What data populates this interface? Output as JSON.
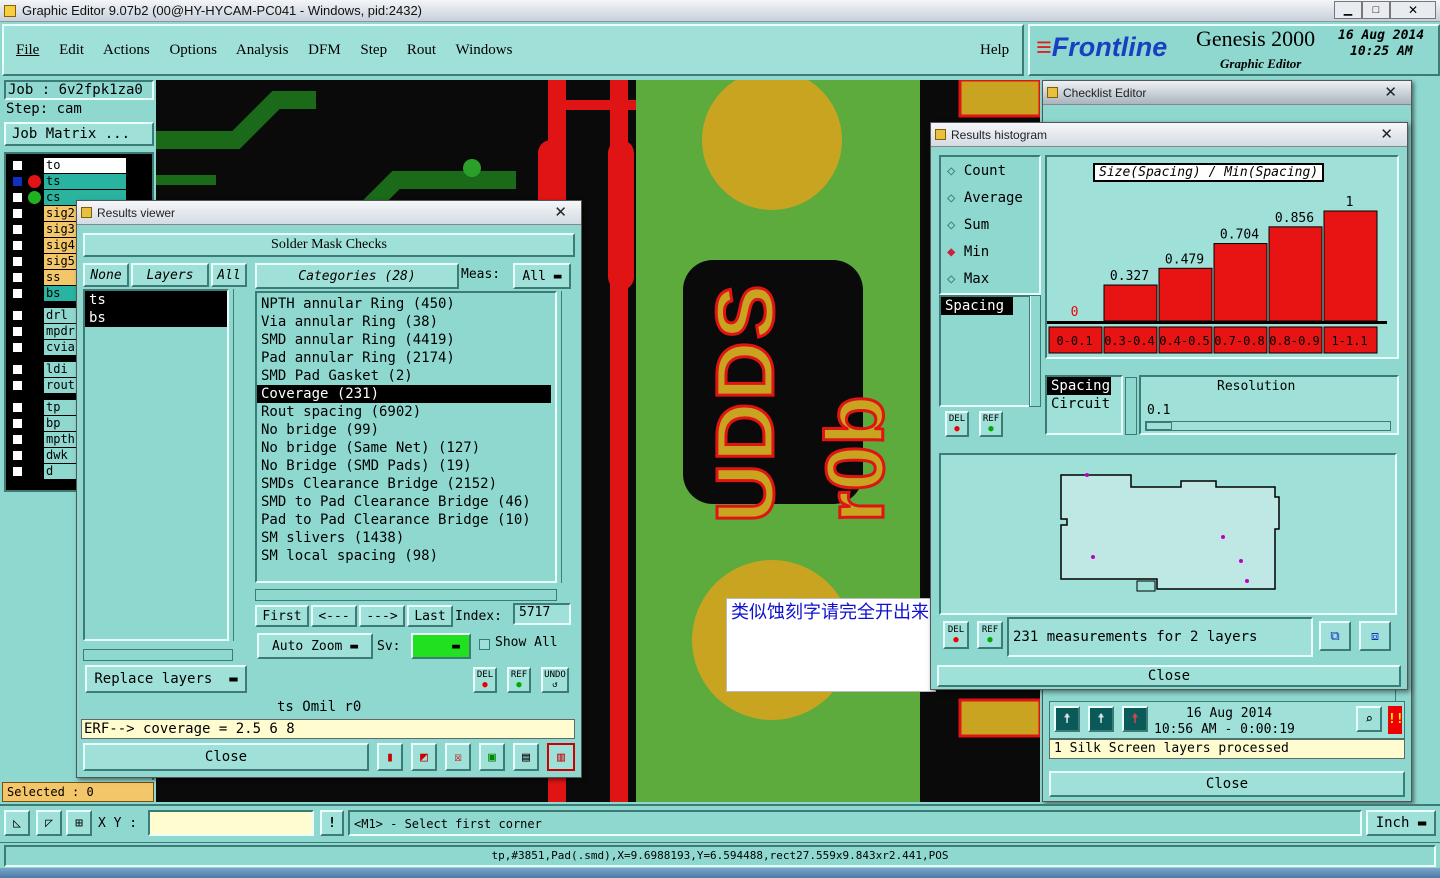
{
  "window": {
    "title": "Graphic Editor 9.07b2 (00@HY-HYCAM-PC041 - Windows, pid:2432)"
  },
  "menu": [
    "File",
    "Edit",
    "Actions",
    "Options",
    "Analysis",
    "DFM",
    "Step",
    "Rout",
    "Windows"
  ],
  "help": "Help",
  "brand": {
    "logo": "Frontline",
    "product": "Genesis 2000",
    "subtitle": "Graphic Editor",
    "date": "16 Aug 2014",
    "time": "10:25 AM"
  },
  "job": {
    "job": "Job : 6v2fpk1za0",
    "step": "Step: cam",
    "matrix": "Job Matrix ..."
  },
  "layers": [
    "to",
    "ts",
    "cs",
    "sig2",
    "sig3",
    "sig4",
    "sig5",
    "ss",
    "bs",
    "drl",
    "mpdr",
    "cvia",
    "ldi",
    "rout",
    "tp",
    "bp",
    "mpth",
    "dwk",
    "d"
  ],
  "selected": "Selected : 0",
  "board": {
    "text1": "UDDS",
    "text2": "r0b"
  },
  "note": "类似蚀刻字请完全开出来",
  "results": {
    "title": "Results viewer",
    "heading": "Solder Mask Checks",
    "none": "None",
    "layers": "Layers",
    "all": "All",
    "categories": "Categories (28)",
    "meas_label": "Meas:",
    "meas_value": "All",
    "layer_items": [
      "ts",
      "bs"
    ],
    "items": [
      "NPTH annular Ring (450)",
      "Via annular Ring (38)",
      "SMD annular Ring (4419)",
      "Pad annular Ring (2174)",
      "SMD Pad Gasket (2)",
      "Coverage (231)",
      "Rout spacing (6902)",
      "No bridge (99)",
      "No bridge (Same Net) (127)",
      "No Bridge (SMD Pads) (19)",
      "SMDs Clearance Bridge (2152)",
      "SMD to Pad Clearance Bridge (46)",
      "Pad to Pad Clearance Bridge (10)",
      "SM slivers (1438)",
      "SM local spacing (98)"
    ],
    "first": "First",
    "prev": "<---",
    "next": "--->",
    "last": "Last",
    "index_label": "Index:",
    "index_value": "5717",
    "auto_zoom": "Auto Zoom",
    "sv": "Sv:",
    "show_all": "Show All",
    "replace": "Replace layers",
    "del": "DEL",
    "ref": "REF",
    "undo": "UNDO",
    "info": "ts Omil r0",
    "erf": "ERF--> coverage = 2.5 6 8",
    "close": "Close"
  },
  "checklist": {
    "title": "Checklist Editor",
    "date": "16 Aug 2014",
    "time": "10:56 AM - 0:00:19",
    "status": "1 Silk Screen layers processed",
    "close": "Close"
  },
  "histogram": {
    "title": "Results histogram",
    "options": [
      "Count",
      "Average",
      "Sum",
      "Min",
      "Max"
    ],
    "selected": "Min",
    "metric": "Spacing",
    "header": "Size(Spacing) / Min(Spacing)",
    "del": "DEL",
    "ref": "REF",
    "bars": [
      {
        "label": "0",
        "value": 0,
        "range": "0-0.1"
      },
      {
        "label": "0.327",
        "value": 0.327,
        "range": "0.3-0.4"
      },
      {
        "label": "0.479",
        "value": 0.479,
        "range": "0.4-0.5"
      },
      {
        "label": "0.704",
        "value": 0.704,
        "range": "0.7-0.8"
      },
      {
        "label": "0.856",
        "value": 0.856,
        "range": "0.8-0.9"
      },
      {
        "label": "1",
        "value": 1,
        "range": "1-1.1"
      }
    ],
    "types": [
      "Spacing",
      "Circuit"
    ],
    "resolution_label": "Resolution",
    "resolution_value": "0.1",
    "measurements": "231 measurements for 2 layers",
    "close": "Close"
  },
  "bottom": {
    "xy": "X Y :",
    "status": "<M1> - Select first corner",
    "units": "Inch",
    "readout": "tp,#3851,Pad(.smd),X=9.6988193,Y=6.594488,rect27.559x9.843xr2.441,POS"
  }
}
